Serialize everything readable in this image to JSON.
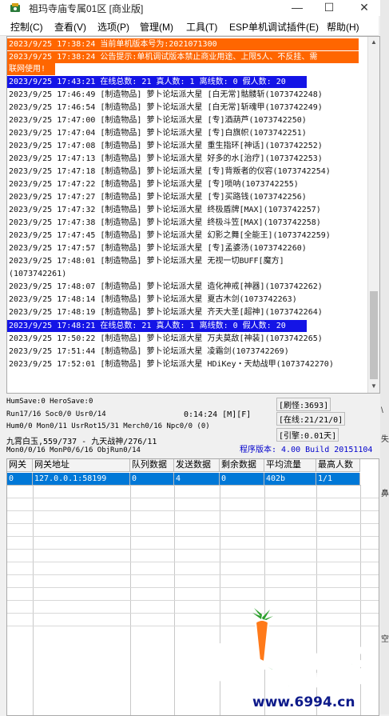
{
  "window": {
    "title": "祖玛寺庙专属01区 [商业版]",
    "minimize": "—",
    "maximize": "☐",
    "close": "✕"
  },
  "menu": [
    "控制(C)",
    "查看(V)",
    "选项(P)",
    "管理(M)",
    "工具(T)",
    "ESP单机调试插件(E)",
    "帮助(H)"
  ],
  "log": [
    {
      "text": "2023/9/25 17:38:24 当前单机版本号为:2021071300",
      "style": "orange"
    },
    {
      "text": "2023/9/25 17:38:24 公告提示:单机调试版本禁止商业用途、上限5人、不反挂、需",
      "style": "orange"
    },
    {
      "text": "联网使用!",
      "style": "orange-short"
    },
    {
      "text": "2023/9/25 17:43:21 在线总数: 21 真人数: 1 离线数: 0 假人数: 20",
      "style": "blue"
    },
    {
      "text": "2023/9/25 17:46:49 [制造物品] 萝卜论坛派大星 [白无常]骷髅斩(1073742248)",
      "style": ""
    },
    {
      "text": "2023/9/25 17:46:54 [制造物品] 萝卜论坛派大星 [白无常]斩魂甲(1073742249)",
      "style": ""
    },
    {
      "text": "2023/9/25 17:47:00 [制造物品] 萝卜论坛派大星 [专]酒葫芦(1073742250)",
      "style": ""
    },
    {
      "text": "2023/9/25 17:47:04 [制造物品] 萝卜论坛派大星 [专]白旗帜(1073742251)",
      "style": ""
    },
    {
      "text": "2023/9/25 17:47:08 [制造物品] 萝卜论坛派大星 重生指环[神话](1073742252)",
      "style": ""
    },
    {
      "text": "2023/9/25 17:47:13 [制造物品] 萝卜论坛派大星 好多的水[治疗](1073742253)",
      "style": ""
    },
    {
      "text": "2023/9/25 17:47:18 [制造物品] 萝卜论坛派大星 [专]背叛者的仪容(1073742254)",
      "style": ""
    },
    {
      "text": "2023/9/25 17:47:22 [制造物品] 萝卜论坛派大星 [专]唢呐(1073742255)",
      "style": ""
    },
    {
      "text": "2023/9/25 17:47:27 [制造物品] 萝卜论坛派大星 [专]买路钱(1073742256)",
      "style": ""
    },
    {
      "text": "2023/9/25 17:47:32 [制造物品] 萝卜论坛派大星 终极盾牌[MAX](1073742257)",
      "style": ""
    },
    {
      "text": "2023/9/25 17:47:38 [制造物品] 萝卜论坛派大星 终极斗笠[MAX](1073742258)",
      "style": ""
    },
    {
      "text": "2023/9/25 17:47:45 [制造物品] 萝卜论坛派大星 幻影之舞[全能王](1073742259)",
      "style": ""
    },
    {
      "text": "2023/9/25 17:47:57 [制造物品] 萝卜论坛派大星 [专]孟婆汤(1073742260)",
      "style": ""
    },
    {
      "text": "2023/9/25 17:48:01 [制造物品] 萝卜论坛派大星 无视一切BUFF[魔方]",
      "style": ""
    },
    {
      "text": "(1073742261)",
      "style": ""
    },
    {
      "text": "2023/9/25 17:48:07 [制造物品] 萝卜论坛派大星 造化神戒[神器](1073742262)",
      "style": ""
    },
    {
      "text": "2023/9/25 17:48:14 [制造物品] 萝卜论坛派大星 夏古木剑(1073742263)",
      "style": ""
    },
    {
      "text": "2023/9/25 17:48:19 [制造物品] 萝卜论坛派大星 齐天大圣[超神](1073742264)",
      "style": ""
    },
    {
      "text": "2023/9/25 17:48:21 在线总数: 21 真人数: 1 离线数: 0 假人数: 20",
      "style": "blue"
    },
    {
      "text": "2023/9/25 17:50:22 [制造物品] 萝卜论坛派大星 万夫莫敌[神装](1073742265)",
      "style": ""
    },
    {
      "text": "2023/9/25 17:51:44 [制造物品] 萝卜论坛派大星 凌霜剑(1073742269)",
      "style": ""
    },
    {
      "text": "2023/9/25 17:52:01 [制造物品] 萝卜论坛派大星 HDiKey・天劫战甲(1073742270)",
      "style": ""
    }
  ],
  "status": {
    "line1": "HumSave:0 HeroSave:0",
    "line2": "Run17/16 Soc0/0 Usr0/14",
    "timer": "0:14:24 [M][F]",
    "line3": "Hum0/0 Mon0/11 UsrRot15/31 Merch0/16 Npc0/0 (0)",
    "line4": "九霄白玉,559/737 - 九天战神/276/11",
    "line5": "Mon0/0/16 MonP0/6/16 ObjRun0/14",
    "refresh": "[刷怪:3693]",
    "online": "[在线:21/21/0]",
    "engine": "[引擎:0.01天]",
    "version": "程序版本: 4.00 Build 20151104"
  },
  "gate_table": {
    "columns": [
      "网关",
      "网关地址",
      "队列数据",
      "发送数据",
      "剩余数据",
      "平均流量",
      "最高人数"
    ],
    "rows": [
      [
        "0",
        "127.0.0.1:58199",
        "0",
        "4",
        "0",
        "402b",
        "1/1"
      ]
    ]
  },
  "side_glyphs": [
    "\\",
    "失",
    "鼻",
    "空"
  ],
  "watermark": {
    "brand": "萝卜论坛",
    "url": "www.6994.cn"
  }
}
